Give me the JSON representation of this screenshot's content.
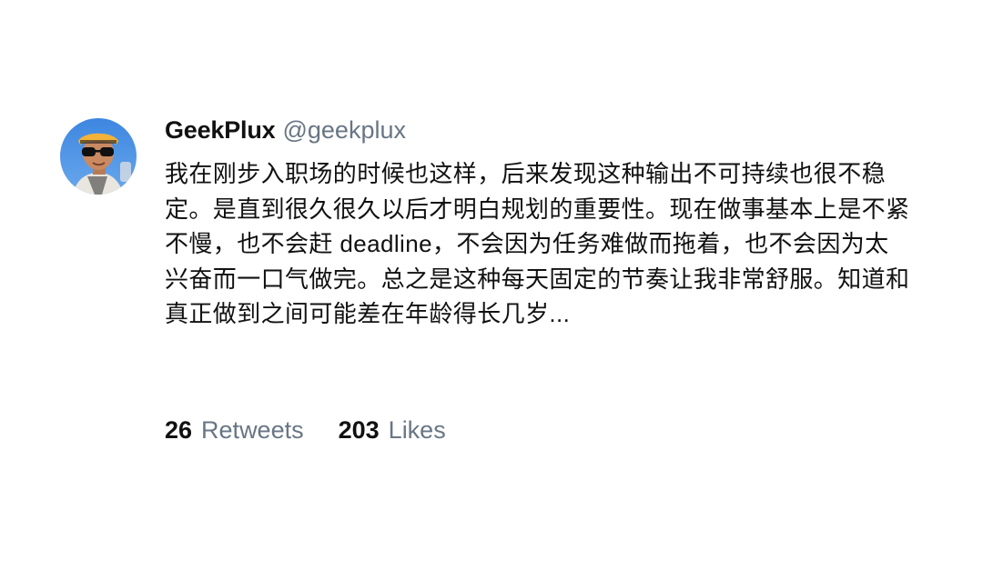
{
  "tweet": {
    "display_name": "GeekPlux",
    "handle": "@geekplux",
    "text": "我在刚步入职场的时候也这样，后来发现这种输出不可持续也很不稳定。是直到很久很久以后才明白规划的重要性。现在做事基本上是不紧不慢，也不会赶 deadline，不会因为任务难做而拖着，也不会因为太兴奋而一口气做完。总之是这种每天固定的节奏让我非常舒服。知道和真正做到之间可能差在年龄得长几岁..."
  },
  "stats": {
    "retweets_count": "26",
    "retweets_label": "Retweets",
    "likes_count": "203",
    "likes_label": "Likes"
  },
  "colors": {
    "text_primary": "#111111",
    "text_secondary": "#687684",
    "background": "#ffffff"
  }
}
